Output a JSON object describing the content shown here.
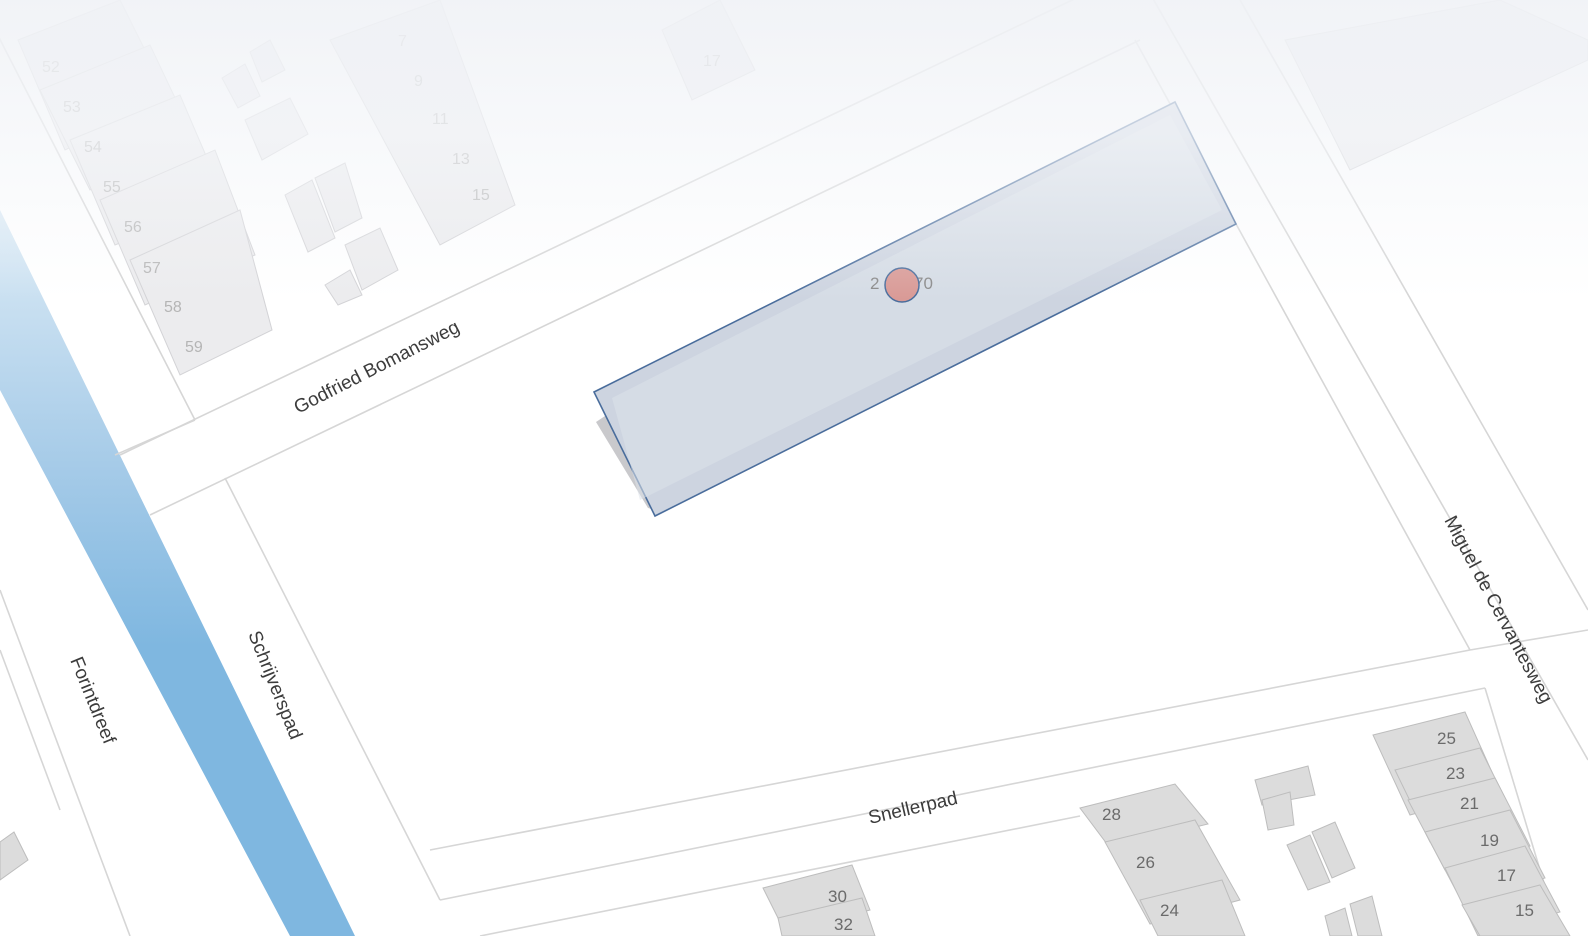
{
  "map": {
    "streets": {
      "godfried": "Godfried Bomansweg",
      "schrijverspad": "Schrijverspad",
      "forintdreef": "Forintdreef",
      "snellerpad": "Snellerpad",
      "miguel": "Miguel de Cervantesweg"
    },
    "selected_building": {
      "house_number_left": "2",
      "house_number_right": "70",
      "fill_color": "#cdd4e0",
      "outline_color": "#4a6d9c",
      "marker_color": "#d99a96"
    },
    "house_numbers": {
      "left_row": [
        "52",
        "53",
        "54",
        "55",
        "56",
        "57",
        "58",
        "59"
      ],
      "upper_row": [
        "7",
        "9",
        "11",
        "13",
        "15"
      ],
      "top_isolated": "17",
      "bottom_right_row": [
        "25",
        "23",
        "21",
        "19",
        "17",
        "15"
      ],
      "bottom_middle": [
        "28",
        "26",
        "24"
      ],
      "bottom_left": [
        "30",
        "32"
      ]
    },
    "water_color": "#7fb7e0"
  }
}
